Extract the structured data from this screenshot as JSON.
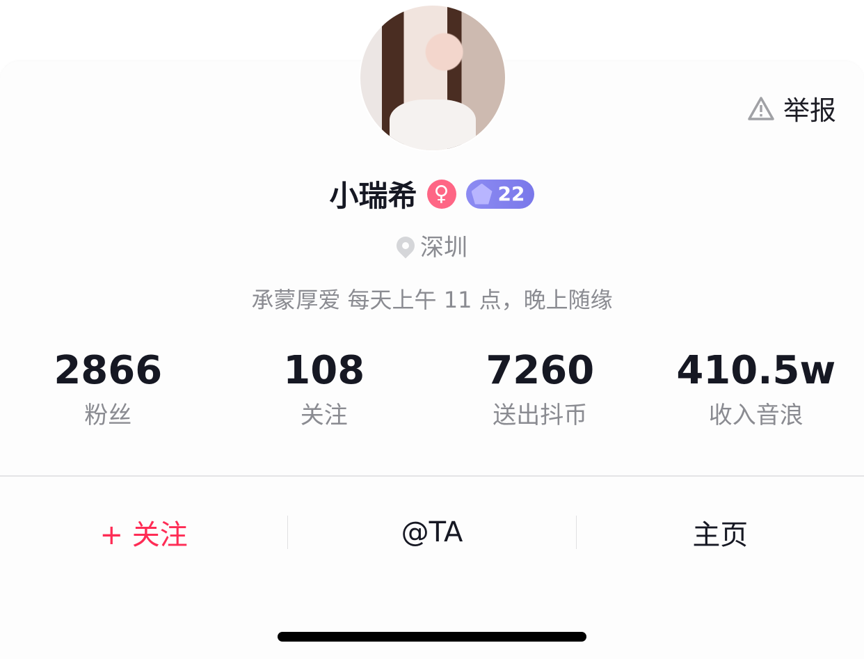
{
  "header": {
    "report_label": "举报"
  },
  "profile": {
    "name": "小瑞希",
    "gender_symbol": "♀",
    "level": "22",
    "location": "深圳",
    "bio": "承蒙厚爱 每天上午 11 点，晚上随缘"
  },
  "stats": [
    {
      "value": "2866",
      "label": "粉丝"
    },
    {
      "value": "108",
      "label": "关注"
    },
    {
      "value": "7260",
      "label": "送出抖币"
    },
    {
      "value": "410.5w",
      "label": "收入音浪"
    }
  ],
  "actions": {
    "follow": "+ 关注",
    "mention": "@TA",
    "homepage": "主页"
  },
  "colors": {
    "accent": "#fe2c55",
    "gender": "#fe6685",
    "level": "#7a78ea"
  }
}
